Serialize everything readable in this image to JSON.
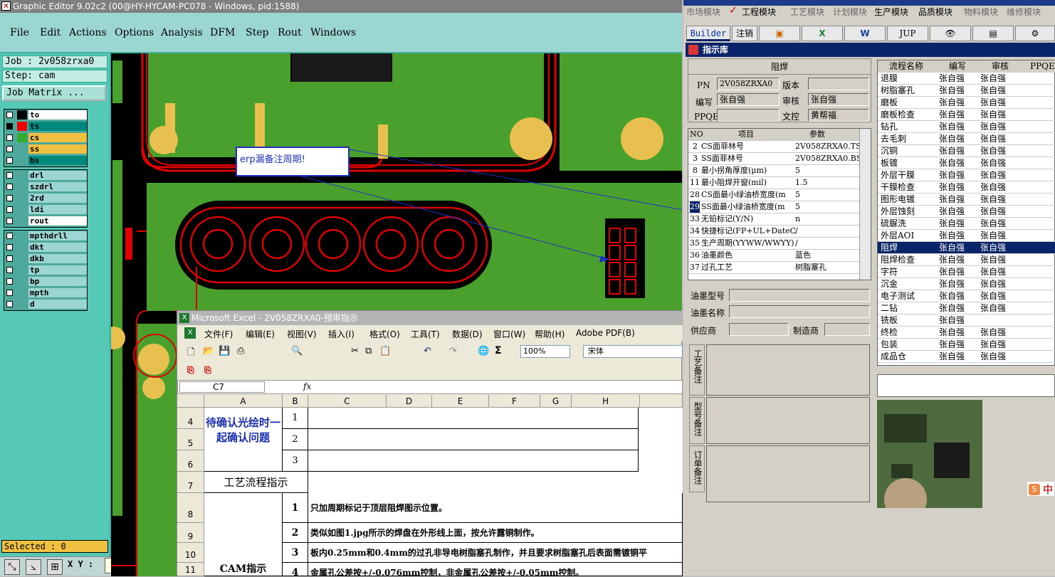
{
  "left_window": {
    "title": "Graphic Editor 9.02c2 (00@HY-HYCAM-PC078 - Windows, pid:1588)",
    "menu": [
      "File",
      "Edit",
      "Actions",
      "Options",
      "Analysis",
      "DFM",
      "Step",
      "Rout",
      "Windows"
    ],
    "job_label": "Job : 2v058zrxa0",
    "step_label": "Step: cam",
    "job_matrix_button": "Job Matrix ...",
    "layers_group1": [
      {
        "name": "to",
        "color": "#ffffff"
      },
      {
        "name": "ts",
        "color": "#008a7e"
      },
      {
        "name": "cs",
        "color": "#f0c040"
      },
      {
        "name": "ss",
        "color": "#f0c040"
      },
      {
        "name": "bs",
        "color": "#008a7e"
      }
    ],
    "layers_group2": [
      {
        "name": "drl",
        "color": "#9bd6d2"
      },
      {
        "name": "szdrl",
        "color": "#9bd6d2"
      },
      {
        "name": "2rd",
        "color": "#9bd6d2"
      },
      {
        "name": "ldi",
        "color": "#9bd6d2"
      },
      {
        "name": "rout",
        "color": "#ffffff"
      }
    ],
    "layers_group3": [
      {
        "name": "mpthdrll",
        "color": "#9bd6d2"
      },
      {
        "name": "dkt",
        "color": "#9bd6d2"
      },
      {
        "name": "dkb",
        "color": "#9bd6d2"
      },
      {
        "name": "tp",
        "color": "#9bd6d2"
      },
      {
        "name": "bp",
        "color": "#9bd6d2"
      },
      {
        "name": "mpth",
        "color": "#9bd6d2"
      },
      {
        "name": "d",
        "color": "#9bd6d2"
      }
    ],
    "selected_label": "Selected : 0",
    "xy_label": "X Y :",
    "annotation_text": "erp漏备注周期!"
  },
  "excel": {
    "title": "Microsoft Excel - 2V058ZRXA0-预审指示",
    "menu": [
      "文件(F)",
      "编辑(E)",
      "视图(V)",
      "插入(I)",
      "格式(O)",
      "工具(T)",
      "数据(D)",
      "窗口(W)",
      "帮助(H)",
      "Adobe PDF(B)"
    ],
    "zoom": "100%",
    "font": "宋体",
    "cell_ref": "C7",
    "fx": "fx",
    "columns": [
      "A",
      "B",
      "C",
      "D",
      "E",
      "F",
      "G",
      "H"
    ],
    "rows": [
      "4",
      "5",
      "6",
      "7",
      "8",
      "9",
      "10",
      "11"
    ],
    "confirm_text": "待确认光绘时一起确认问题",
    "b_numbers": [
      "1",
      "2",
      "3"
    ],
    "process_header": "工艺流程指示",
    "cam_label": "CAM指示",
    "instructions": [
      {
        "n": "1",
        "text": "只加周期标记于顶层阻焊图示位置。"
      },
      {
        "n": "2",
        "text": "类似如图1.jpg所示的焊盘在外形线上面，按允许露铜制作。"
      },
      {
        "n": "3",
        "text": "板内0.25mm和0.4mm的过孔非导电树脂塞孔制作，并且要求树脂塞孔后表面需镀铜平"
      },
      {
        "n": "4",
        "text": "金属孔公差按+/-0.076mm控制，非金属孔公差按+/-0.05mm控制。"
      }
    ]
  },
  "right_window": {
    "modules": [
      "市场模块",
      "工程模块",
      "工艺模块",
      "计划模块",
      "生产模块",
      "品质模块",
      "物料模块",
      "维修模块"
    ],
    "toolbar": [
      "Builder",
      "注销",
      "",
      "",
      "",
      "JUP",
      "",
      "",
      ""
    ],
    "subwindow_title": "指示库",
    "section_title": "阻焊",
    "form": {
      "pn_label": "PN",
      "pn_value": "2V058ZRXA0",
      "version_label": "版本",
      "version_value": "",
      "author_label": "编写",
      "author_value": "张自强",
      "review_label": "审核",
      "review_value": "张自强",
      "ppqe_label": "PPQE",
      "ppqe_value": "",
      "control_label": "文控",
      "control_value": "黄帮福"
    },
    "param_headers": [
      "NO",
      "项目",
      "参数"
    ],
    "params": [
      {
        "no": "2",
        "item": "CS面菲林号",
        "val": "2V058ZRXA0.TS"
      },
      {
        "no": "3",
        "item": "SS面菲林号",
        "val": "2V058ZRXA0.BS"
      },
      {
        "no": "8",
        "item": "最小拐角厚度(μm)",
        "val": "5"
      },
      {
        "no": "11",
        "item": "最小阻焊开窗(mil)",
        "val": "1.5"
      },
      {
        "no": "28",
        "item": "CS面最小绿油桥宽度(m",
        "val": "5"
      },
      {
        "no": "29",
        "item": "SS面最小绿油桥宽度(m",
        "val": "5"
      },
      {
        "no": "33",
        "item": "无铅标记(Y/N)",
        "val": "n"
      },
      {
        "no": "34",
        "item": "快捷标记(FP+UL+DateC",
        "val": "/"
      },
      {
        "no": "35",
        "item": "生产周期(YYWW/WWYY)",
        "val": "/"
      },
      {
        "no": "36",
        "item": "油墨颜色",
        "val": "蓝色"
      },
      {
        "no": "37",
        "item": "过孔工艺",
        "val": "树脂塞孔"
      }
    ],
    "ink_type_label": "油墨型号",
    "ink_name_label": "油墨名称",
    "supplier_label": "供应商",
    "maker_label": "制造商",
    "tabs": [
      "工艺备注",
      "型号备注",
      "订单备注"
    ],
    "flow_headers": [
      "流程名称",
      "编写",
      "审核",
      "PPQE"
    ],
    "flow": [
      {
        "name": "退膜",
        "a": "张自强",
        "b": "张自强"
      },
      {
        "name": "树脂塞孔",
        "a": "张自强",
        "b": "张自强"
      },
      {
        "name": "磨板",
        "a": "张自强",
        "b": "张自强"
      },
      {
        "name": "磨板检查",
        "a": "张自强",
        "b": "张自强"
      },
      {
        "name": "钻孔",
        "a": "张自强",
        "b": "张自强"
      },
      {
        "name": "去毛刺",
        "a": "张自强",
        "b": "张自强"
      },
      {
        "name": "沉铜",
        "a": "张自强",
        "b": "张自强"
      },
      {
        "name": "板镀",
        "a": "张自强",
        "b": "张自强"
      },
      {
        "name": "外层干膜",
        "a": "张自强",
        "b": "张自强"
      },
      {
        "name": "干膜检查",
        "a": "张自强",
        "b": "张自强"
      },
      {
        "name": "图形电镀",
        "a": "张自强",
        "b": "张自强"
      },
      {
        "name": "外层蚀刻",
        "a": "张自强",
        "b": "张自强"
      },
      {
        "name": "硫脲洗",
        "a": "张自强",
        "b": "张自强"
      },
      {
        "name": "外层AOI",
        "a": "张自强",
        "b": "张自强"
      },
      {
        "name": "阻焊",
        "a": "张自强",
        "b": "张自强"
      },
      {
        "name": "阻焊检查",
        "a": "张自强",
        "b": "张自强"
      },
      {
        "name": "字符",
        "a": "张自强",
        "b": "张自强"
      },
      {
        "name": "沉金",
        "a": "张自强",
        "b": "张自强"
      },
      {
        "name": "电子测试",
        "a": "张自强",
        "b": "张自强"
      },
      {
        "name": "二钻",
        "a": "张自强",
        "b": "张自强"
      },
      {
        "name": "铣板",
        "a": "张自强",
        "b": ""
      },
      {
        "name": "终检",
        "a": "张自强",
        "b": "张自强"
      },
      {
        "name": "包装",
        "a": "张自强",
        "b": "张自强"
      },
      {
        "name": "成品仓",
        "a": "张自强",
        "b": "张自强"
      }
    ],
    "selected_flow_index": 14,
    "ime_label": "中"
  }
}
